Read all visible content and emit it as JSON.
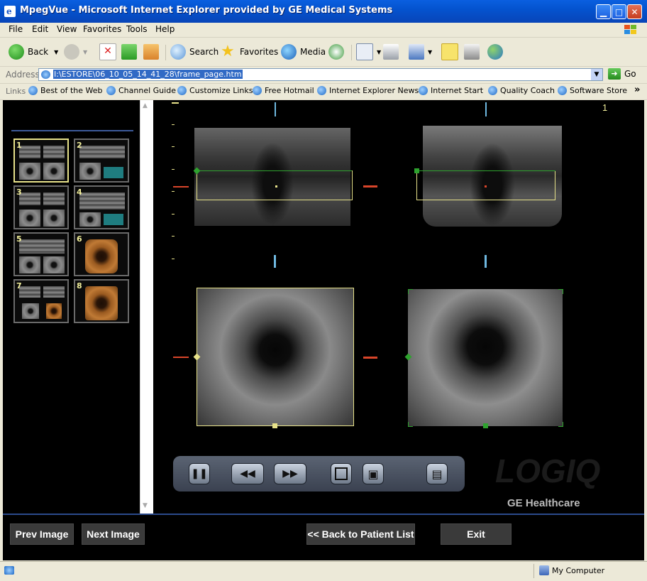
{
  "window": {
    "title": "MpegVue - Microsoft Internet Explorer provided by GE Medical Systems"
  },
  "menu": [
    "File",
    "Edit",
    "View",
    "Favorites",
    "Tools",
    "Help"
  ],
  "toolbar": {
    "back_label": "Back",
    "search_label": "Search",
    "favorites_label": "Favorites",
    "media_label": "Media"
  },
  "address": {
    "label": "Address",
    "url": "I:\\ESTORE\\06_10_05_14_41_28\\frame_page.htm",
    "go_label": "Go"
  },
  "links": {
    "label": "Links",
    "items": [
      "Best of the Web",
      "Channel Guide",
      "Customize Links",
      "Free Hotmail",
      "Internet Explorer News",
      "Internet Start",
      "Quality Coach",
      "Software Store"
    ],
    "more": "»"
  },
  "thumbnails": [
    {
      "num": "1"
    },
    {
      "num": "2"
    },
    {
      "num": "3"
    },
    {
      "num": "4"
    },
    {
      "num": "5"
    },
    {
      "num": "6"
    },
    {
      "num": "7"
    },
    {
      "num": "8"
    }
  ],
  "viewer": {
    "frame_number": "1",
    "logo_text": "LOGIQ",
    "brand": "GE Healthcare"
  },
  "nav_buttons": {
    "prev": "Prev Image",
    "next": "Next Image",
    "back": "<< Back to Patient List",
    "exit": "Exit"
  },
  "statusbar": {
    "zone": "My Computer"
  },
  "colors": {
    "selected_thumb": "#e7e28a",
    "marker_green": "#2ea22e",
    "marker_yellow": "#e7e28a",
    "marker_red": "#d8452a",
    "marker_blue": "#6fb8e0"
  }
}
